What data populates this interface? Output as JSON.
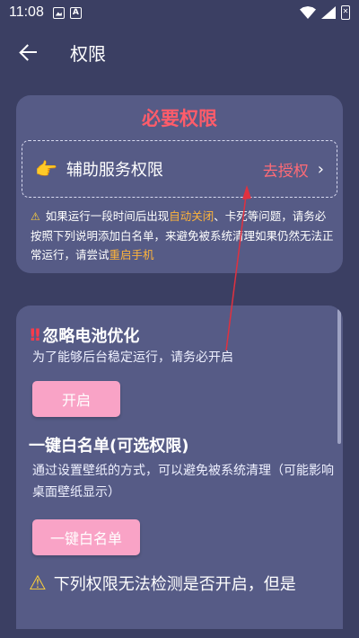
{
  "status_bar": {
    "time": "11:08"
  },
  "toolbar": {
    "title": "权限"
  },
  "required": {
    "title": "必要权限",
    "auth_label": "辅助服务权限",
    "auth_action": "去授权",
    "notice_part1": "如果运行一段时间后出现",
    "notice_hl1": "自动关闭",
    "notice_part2": "、卡死等问题，请务必按照下列说明添加白名单，来避免被系统清理如果仍然无法正常运行，请尝试",
    "notice_hl2": "重启手机"
  },
  "battery": {
    "title": "忽略电池优化",
    "desc": "为了能够后台稳定运行，请务必开启",
    "button": "开启"
  },
  "whitelist": {
    "title": "一键白名单(可选权限)",
    "desc": "通过设置壁纸的方式，可以避免被系统清理（可能影响桌面壁纸显示）",
    "button": "一键白名单"
  },
  "undetectable": {
    "text": "下列权限无法检测是否开启，但是"
  },
  "colors": {
    "background": "#3b3f63",
    "card": "#565b86",
    "accent_red": "#ff5c6a",
    "highlight": "#ffb43a",
    "button_pink": "#f9a3c6"
  }
}
